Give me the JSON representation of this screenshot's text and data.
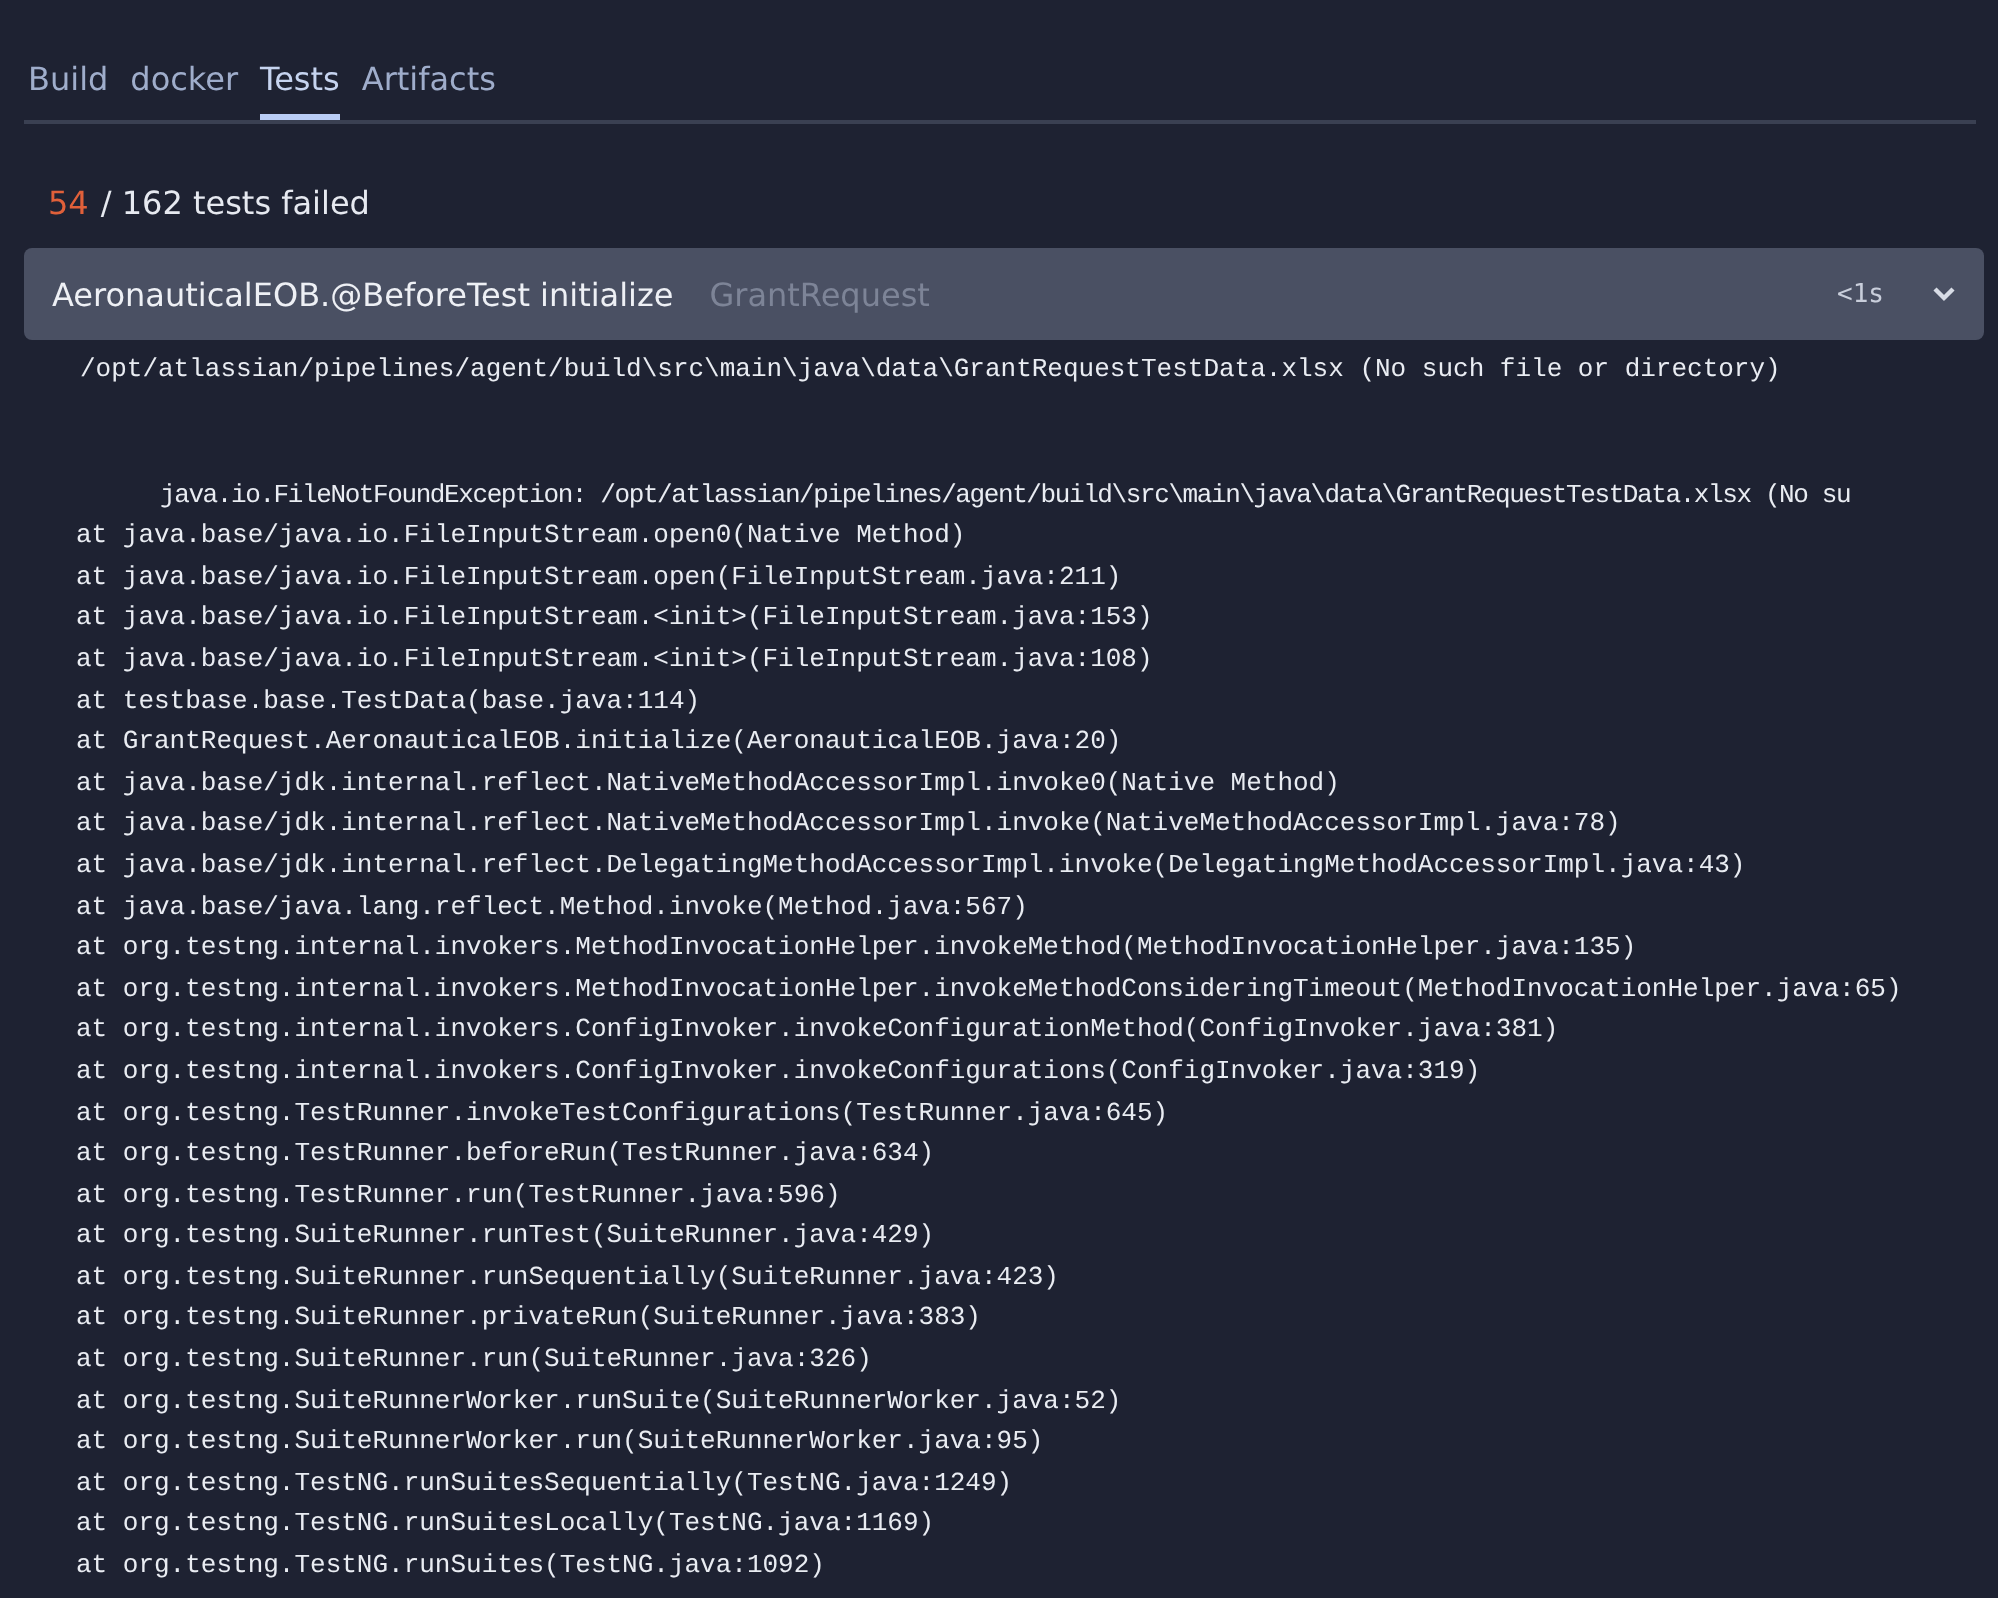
{
  "tabs": [
    {
      "label": "Build",
      "selected": false
    },
    {
      "label": "docker",
      "selected": false
    },
    {
      "label": "Tests",
      "selected": true
    },
    {
      "label": "Artifacts",
      "selected": false
    }
  ],
  "summary": {
    "failed": "54",
    "rest": "/ 162 tests failed"
  },
  "test": {
    "name": "AeronauticalEOB.@BeforeTest initialize",
    "group": "GrantRequest",
    "duration": "<1s",
    "expanded": true,
    "message": "/opt/atlassian/pipelines/agent/build\\src\\main\\java\\data\\GrantRequestTestData.xlsx (No such file or directory)",
    "exception": "java.io.FileNotFoundException: /opt/atlassian/pipelines/agent/build\\src\\main\\java\\data\\GrantRequestTestData.xlsx (No su",
    "stack": [
      "at java.base/java.io.FileInputStream.open0(Native Method)",
      "at java.base/java.io.FileInputStream.open(FileInputStream.java:211)",
      "at java.base/java.io.FileInputStream.<init>(FileInputStream.java:153)",
      "at java.base/java.io.FileInputStream.<init>(FileInputStream.java:108)",
      "at testbase.base.TestData(base.java:114)",
      "at GrantRequest.AeronauticalEOB.initialize(AeronauticalEOB.java:20)",
      "at java.base/jdk.internal.reflect.NativeMethodAccessorImpl.invoke0(Native Method)",
      "at java.base/jdk.internal.reflect.NativeMethodAccessorImpl.invoke(NativeMethodAccessorImpl.java:78)",
      "at java.base/jdk.internal.reflect.DelegatingMethodAccessorImpl.invoke(DelegatingMethodAccessorImpl.java:43)",
      "at java.base/java.lang.reflect.Method.invoke(Method.java:567)",
      "at org.testng.internal.invokers.MethodInvocationHelper.invokeMethod(MethodInvocationHelper.java:135)",
      "at org.testng.internal.invokers.MethodInvocationHelper.invokeMethodConsideringTimeout(MethodInvocationHelper.java:65)",
      "at org.testng.internal.invokers.ConfigInvoker.invokeConfigurationMethod(ConfigInvoker.java:381)",
      "at org.testng.internal.invokers.ConfigInvoker.invokeConfigurations(ConfigInvoker.java:319)",
      "at org.testng.TestRunner.invokeTestConfigurations(TestRunner.java:645)",
      "at org.testng.TestRunner.beforeRun(TestRunner.java:634)",
      "at org.testng.TestRunner.run(TestRunner.java:596)",
      "at org.testng.SuiteRunner.runTest(SuiteRunner.java:429)",
      "at org.testng.SuiteRunner.runSequentially(SuiteRunner.java:423)",
      "at org.testng.SuiteRunner.privateRun(SuiteRunner.java:383)",
      "at org.testng.SuiteRunner.run(SuiteRunner.java:326)",
      "at org.testng.SuiteRunnerWorker.runSuite(SuiteRunnerWorker.java:52)",
      "at org.testng.SuiteRunnerWorker.run(SuiteRunnerWorker.java:95)",
      "at org.testng.TestNG.runSuitesSequentially(TestNG.java:1249)",
      "at org.testng.TestNG.runSuitesLocally(TestNG.java:1169)",
      "at org.testng.TestNG.runSuites(TestNG.java:1092)"
    ]
  }
}
